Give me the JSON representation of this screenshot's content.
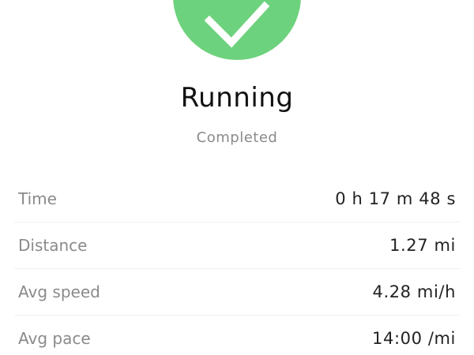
{
  "status": {
    "icon": "checkmark-icon",
    "color": "#6dd27d"
  },
  "activity": {
    "title": "Running",
    "status": "Completed"
  },
  "stats": [
    {
      "label": "Time",
      "value": "0 h 17 m 48 s"
    },
    {
      "label": "Distance",
      "value": "1.27 mi"
    },
    {
      "label": "Avg speed",
      "value": "4.28 mi/h"
    },
    {
      "label": "Avg pace",
      "value": "14:00 /mi"
    }
  ]
}
